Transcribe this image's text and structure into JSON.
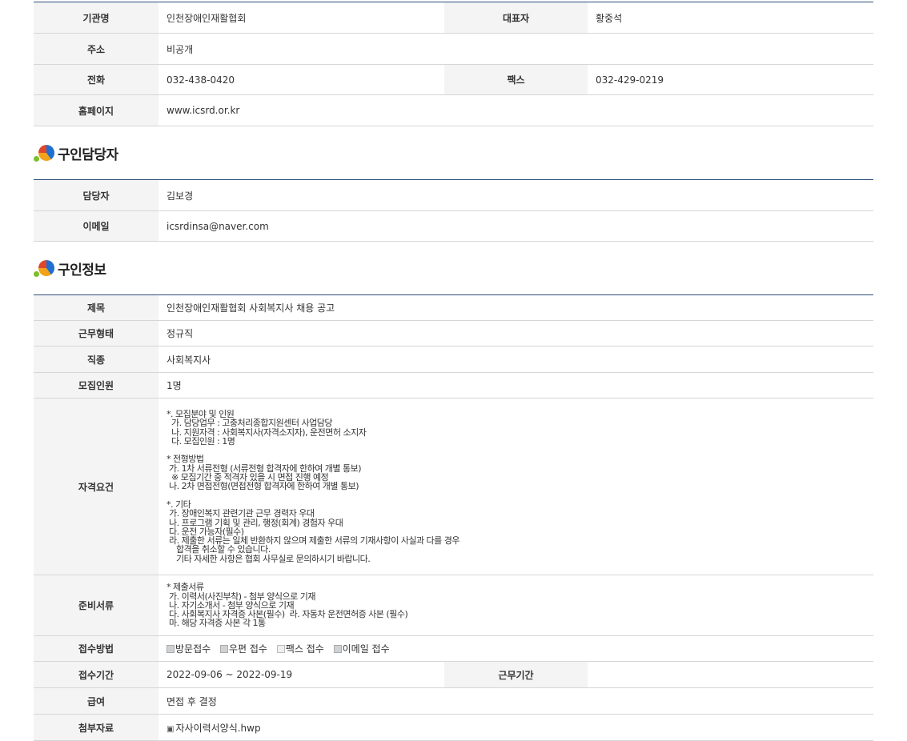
{
  "org": {
    "name_label": "기관명",
    "name_value": "인천장애인재활협회",
    "rep_label": "대표자",
    "rep_value": "황중석",
    "addr_label": "주소",
    "addr_value": "비공개",
    "phone_label": "전화",
    "phone_value": "032-438-0420",
    "fax_label": "팩스",
    "fax_value": "032-429-0219",
    "home_label": "홈페이지",
    "home_value": "www.icsrd.or.kr"
  },
  "contact": {
    "title": "구인담당자",
    "person_label": "담당자",
    "person_value": "김보경",
    "email_label": "이메일",
    "email_value": "icsrdinsa@naver.com"
  },
  "job": {
    "title": "구인정보",
    "subject_label": "제목",
    "subject_value": "인천장애인재활협회 사회복지사 채용 공고",
    "type_label": "근무형태",
    "type_value": "정규직",
    "role_label": "직종",
    "role_value": "사회복지사",
    "count_label": "모집인원",
    "count_value": "1명",
    "qual_label": "자격요건",
    "qual_value": "*. 모집분야 및 인원\n  가. 담당업무 : 고충처리종합지원센터 사업담당\n  나. 지원자격 : 사회복지사(자격소지자), 운전면허 소지자\n  다. 모집인원 : 1명\n\n* 전형방법\n 가. 1차 서류전형 (서류전형 합격자에 한하여 개별 통보)\n  ※ 모집기간 중 적격자 있을 시 면접 진행 예정\n 나. 2차 면접전형(면접전형 합격자에 한하여 개별 통보)\n\n*. 기타\n 가. 장애인복지 관련기관 근무 경력자 우대\n 나. 프로그램 기획 및 관리, 행정(회계) 경험자 우대\n 다. 운전 가능자(필수)\n 라. 제출한 서류는 일체 반환하지 않으며 제출한 서류의 기재사항이 사실과 다를 경우\n    합격을 취소할 수 있습니다.\n    기타 자세한 사항은 협회 사무실로 문의하시기 바랍니다.",
    "docs_label": "준비서류",
    "docs_value": "* 제출서류\n 가. 이력서(사진부착) - 첨부 양식으로 기재\n 나. 자기소개서 - 첨부 양식으로 기재\n 다. 사회복지사 자격증 사본(필수)  라. 자동차 운전면허증 사본 (필수)\n 마. 해당 자격증 사본 각 1통",
    "method_label": "접수방법",
    "methods": [
      {
        "label": "방문접수",
        "checked": true
      },
      {
        "label": "우편 접수",
        "checked": true
      },
      {
        "label": "팩스 접수",
        "checked": false
      },
      {
        "label": "이메일 접수",
        "checked": true
      }
    ],
    "period_label": "접수기간",
    "period_value": "2022-09-06 ~ 2022-09-19",
    "work_period_label": "근무기간",
    "work_period_value": "",
    "salary_label": "급여",
    "salary_value": "면접 후 결정",
    "attach_label": "첨부자료",
    "attach_value": "자사이력서양식.hwp"
  }
}
